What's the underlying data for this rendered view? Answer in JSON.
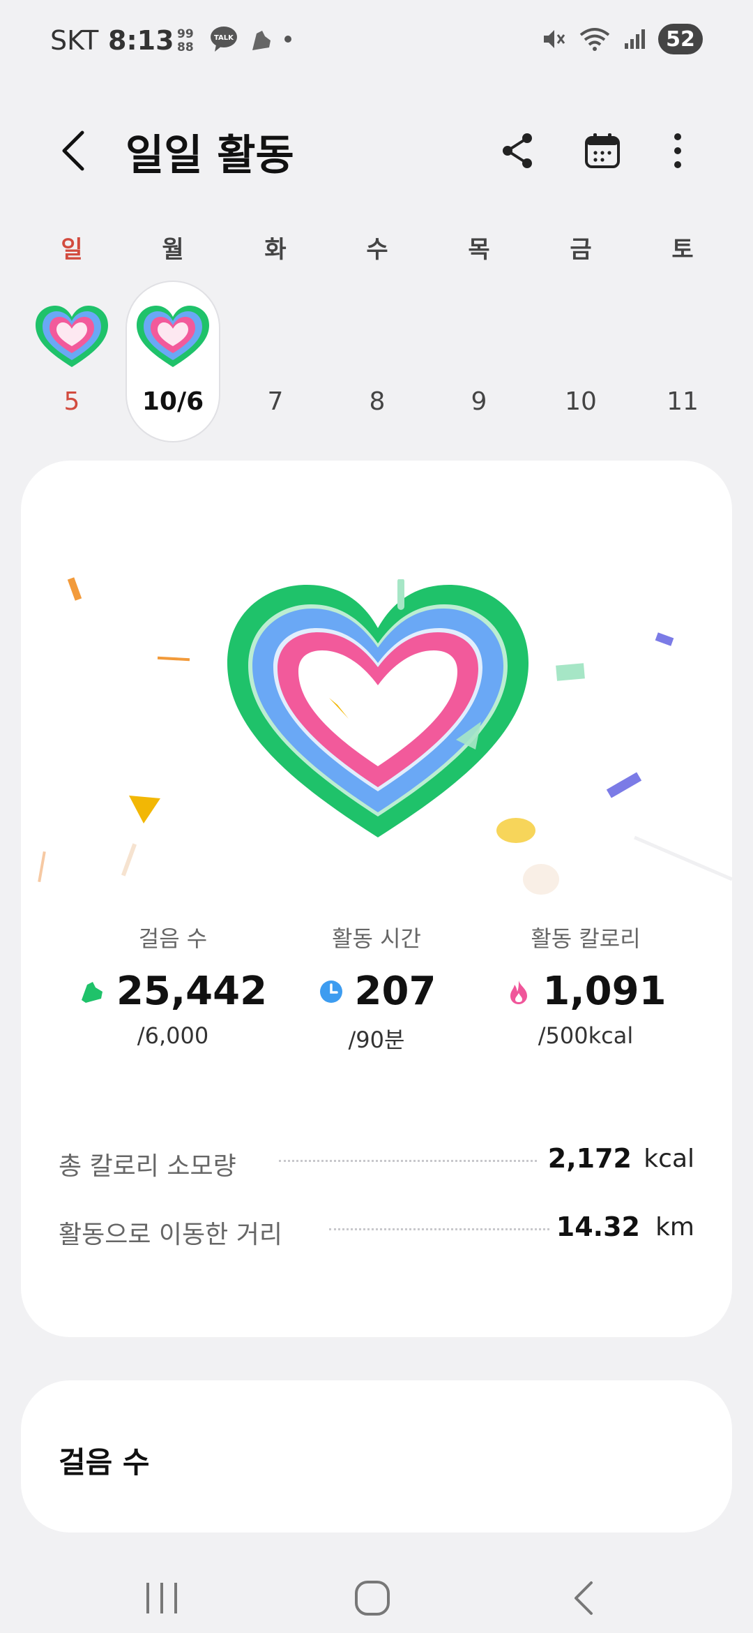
{
  "status_bar": {
    "carrier": "SKT",
    "time": "8:13",
    "battery": "52",
    "left_icons": [
      "app-99-icon",
      "talk-icon",
      "shoe-icon",
      "dot-icon"
    ],
    "right_icons": [
      "mute-icon",
      "wifi-icon",
      "signal-icon"
    ]
  },
  "header": {
    "title": "일일 활동",
    "actions": [
      "share-icon",
      "calendar-icon",
      "more-icon"
    ]
  },
  "week": {
    "days": [
      {
        "dow": "일",
        "date": "5",
        "has_heart": true,
        "selected": false,
        "sunday": true
      },
      {
        "dow": "월",
        "date": "10/6",
        "has_heart": true,
        "selected": true,
        "sunday": false
      },
      {
        "dow": "화",
        "date": "7",
        "has_heart": false,
        "selected": false,
        "sunday": false
      },
      {
        "dow": "수",
        "date": "8",
        "has_heart": false,
        "selected": false,
        "sunday": false
      },
      {
        "dow": "목",
        "date": "9",
        "has_heart": false,
        "selected": false,
        "sunday": false
      },
      {
        "dow": "금",
        "date": "10",
        "has_heart": false,
        "selected": false,
        "sunday": false
      },
      {
        "dow": "토",
        "date": "11",
        "has_heart": false,
        "selected": false,
        "sunday": false
      }
    ]
  },
  "summary": {
    "stats": [
      {
        "label": "걸음 수",
        "value": "25,442",
        "goal": "/6,000",
        "icon": "shoe-icon",
        "color": "#1fc26a"
      },
      {
        "label": "활동 시간",
        "value": "207",
        "goal": "/90분",
        "icon": "clock-icon",
        "color": "#3d9cf0"
      },
      {
        "label": "활동 칼로리",
        "value": "1,091",
        "goal": "/500kcal",
        "icon": "flame-icon",
        "color": "#f0569a"
      }
    ],
    "total_calories": {
      "label": "총 칼로리 소모량",
      "value": "2,172",
      "unit": "kcal"
    },
    "distance": {
      "label": "활동으로 이동한 거리",
      "value": "14.32",
      "unit": "km"
    }
  },
  "steps_card": {
    "title": "걸음 수"
  },
  "colors": {
    "ring_green": "#1fc26a",
    "ring_blue": "#6aa8f5",
    "ring_pink": "#f25a9b",
    "sunday_red": "#d24b3e"
  },
  "nav": [
    "recents-icon",
    "home-icon",
    "back-icon"
  ]
}
